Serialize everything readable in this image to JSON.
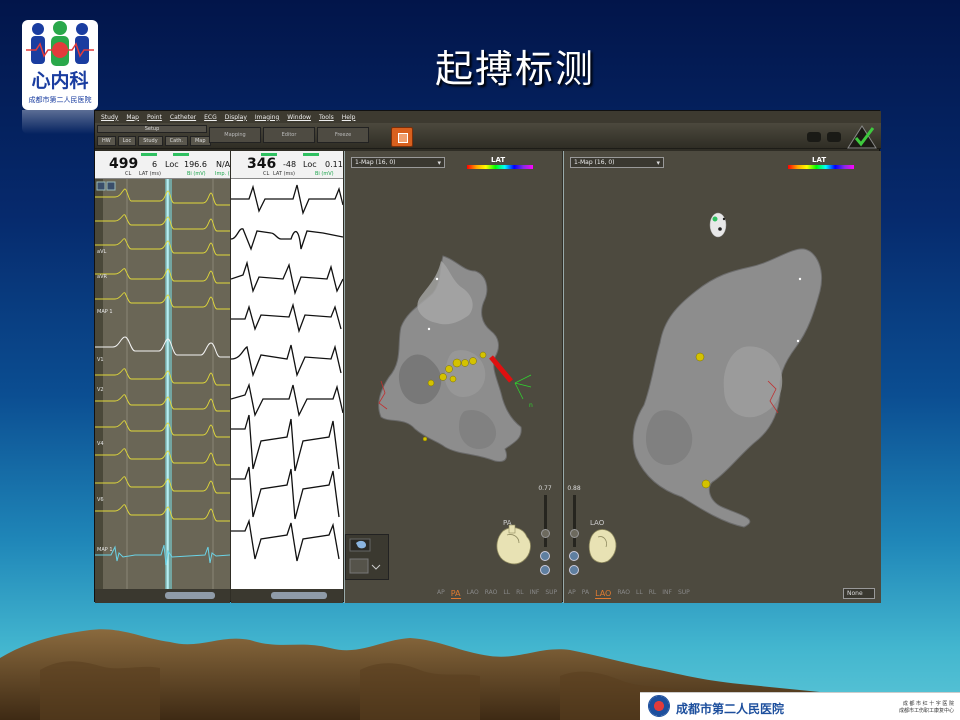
{
  "slide": {
    "title": "起搏标测",
    "logo": {
      "name": "心内科",
      "hospital": "成都市第二人民医院"
    },
    "footer": {
      "name": "成都市第二人民医院",
      "right_line1": "成 都 市 红 十 字 医 院",
      "right_line2": "成都市工伤职工康复中心"
    }
  },
  "app": {
    "menu": [
      "Study",
      "Map",
      "Point",
      "Catheter",
      "ECG",
      "Display",
      "Imaging",
      "Window",
      "Tools",
      "Help"
    ],
    "toolbar": {
      "setup": "Setup",
      "buttons": [
        "HW",
        "Loc",
        "Study",
        "Cath.",
        "Map"
      ],
      "group_buttons": [
        "Mapping",
        "Editor",
        "Freeze"
      ]
    },
    "signals_pane": {
      "cl_value": "499",
      "cl_label": "CL",
      "lat_value": "6",
      "lat_label": "LAT (ms)",
      "loc_label": "Loc",
      "bi_value": "196.6",
      "bi_label": "Bi (mV)",
      "na_value": "N/A",
      "imp_label": "Imp. (",
      "channels": [
        "aVL",
        "aVR",
        "MAP 1",
        "V1",
        "V2",
        "V4",
        "V6",
        "MAP 1"
      ]
    },
    "ecg_pane": {
      "cl_value": "346",
      "cl_label": "CL",
      "lat_value": "-48",
      "lat_label": "LAT (ms)",
      "loc_label": "Loc",
      "bi_value": "0.11",
      "bi_label": "Bi (mV)"
    },
    "map_left": {
      "select": "1-Map (16, 0)",
      "legend": "LAT",
      "slider_value": "0.77",
      "orientation_label": "PA",
      "views": [
        "AP",
        "PA",
        "LAO",
        "RAO",
        "LL",
        "RL",
        "INF",
        "SUP"
      ],
      "active_view": "PA"
    },
    "map_right": {
      "select": "1-Map (16, 0)",
      "legend": "LAT",
      "slider_value": "0.88",
      "orientation_label": "LAO",
      "views": [
        "AP",
        "PA",
        "LAO",
        "RAO",
        "LL",
        "RL",
        "INF",
        "SUP"
      ],
      "active_view": "LAO",
      "none_select": "None"
    }
  },
  "colors": {
    "background_top": "#02154a",
    "background_bottom": "#5cc6d6",
    "app_bg": "#2f2d25",
    "trace_yellow": "#e0d83a",
    "active_tab": "#e07a30",
    "catheter_red": "#e01010",
    "map_point": "#d4c200"
  }
}
